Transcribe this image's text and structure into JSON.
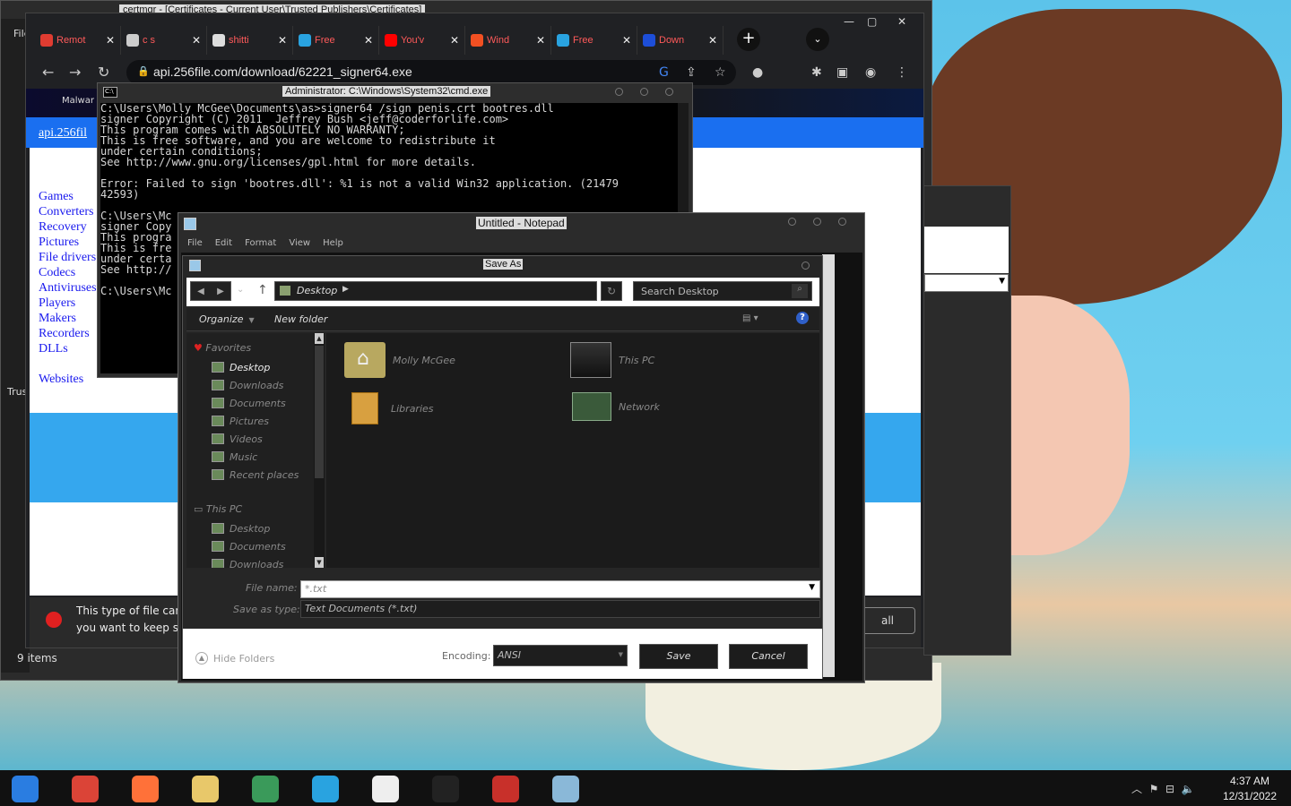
{
  "certmgr": {
    "title": "certmgr - [Certificates - Current User\\Trusted Publishers\\Certificates]",
    "file_menu": "File",
    "trust_label": "Trus",
    "status": "9 items"
  },
  "chrome": {
    "tabs": [
      {
        "label": "Remot",
        "color": "#e03c31"
      },
      {
        "label": "c s",
        "color": "#cccccc"
      },
      {
        "label": "shitti",
        "color": "#dddddd"
      },
      {
        "label": "Free",
        "color": "#29a3e0"
      },
      {
        "label": "You'v",
        "color": "#ff0000"
      },
      {
        "label": "Wind",
        "color": "#f25022"
      },
      {
        "label": "Free",
        "color": "#29a3e0"
      },
      {
        "label": "Down",
        "color": "#1d4ed8"
      }
    ],
    "url": "api.256file.com/download/62221_signer64.exe",
    "site_link": "api.256fil",
    "side_links": [
      "Games",
      "Converters",
      "Recovery",
      "Pictures",
      "File drivers",
      "Codecs",
      "Antiviruses",
      "Players",
      "Makers",
      "Recorders",
      "DLLs"
    ],
    "websites_link": "Websites",
    "download_warning": "This type of file can\nyou want to keep sig",
    "keep_button": "all",
    "banner_label": "Malwar"
  },
  "cmd": {
    "title": "Administrator: C:\\Windows\\System32\\cmd.exe",
    "icon_text": "C:\\",
    "lines": [
      "C:\\Users\\Molly McGee\\Documents\\as>signer64 /sign penis.crt bootres.dll",
      "signer Copyright (C) 2011  Jeffrey Bush <jeff@coderforlife.com>",
      "This program comes with ABSOLUTELY NO WARRANTY;",
      "This is free software, and you are welcome to redistribute it",
      "under certain conditions;",
      "See http://www.gnu.org/licenses/gpl.html for more details.",
      "",
      "Error: Failed to sign 'bootres.dll': %1 is not a valid Win32 application. (21479",
      "42593)",
      "",
      "C:\\Users\\Mc",
      "signer Copy",
      "This progra",
      "This is fre",
      "under certa",
      "See http://",
      "",
      "C:\\Users\\Mc"
    ]
  },
  "notepad": {
    "title": "Untitled - Notepad",
    "menu": [
      "File",
      "Edit",
      "Format",
      "View",
      "Help"
    ]
  },
  "saveas": {
    "title": "Save As",
    "breadcrumb": "Desktop",
    "search_placeholder": "Search Desktop",
    "organize": "Organize",
    "new_folder": "New folder",
    "nav": {
      "favorites": "Favorites",
      "favorites_items": [
        "Desktop",
        "Downloads",
        "Documents",
        "Pictures",
        "Videos",
        "Music",
        "Recent places"
      ],
      "this_pc": "This PC",
      "this_pc_items": [
        "Desktop",
        "Documents",
        "Downloads"
      ]
    },
    "files": [
      {
        "name": "Molly McGee",
        "icon": "user-folder-icon"
      },
      {
        "name": "This PC",
        "icon": "computer-icon"
      },
      {
        "name": "Libraries",
        "icon": "libraries-icon"
      },
      {
        "name": "Network",
        "icon": "network-icon"
      }
    ],
    "file_name_label": "File name:",
    "file_name_value": "*.txt",
    "save_type_label": "Save as type:",
    "save_type_value": "Text Documents (*.txt)",
    "hide_folders": "Hide Folders",
    "encoding_label": "Encoding:",
    "encoding_value": "ANSI",
    "save_button": "Save",
    "cancel_button": "Cancel"
  },
  "taskbar": {
    "time": "4:37 AM",
    "date": "12/31/2022",
    "apps": [
      "windows-photo-icon",
      "chrome-icon",
      "firefox-icon",
      "file-explorer-icon",
      "people-icon",
      "remote-icon",
      "7zip-icon",
      "cmd-icon",
      "toolbox-icon",
      "notepad-icon"
    ]
  }
}
